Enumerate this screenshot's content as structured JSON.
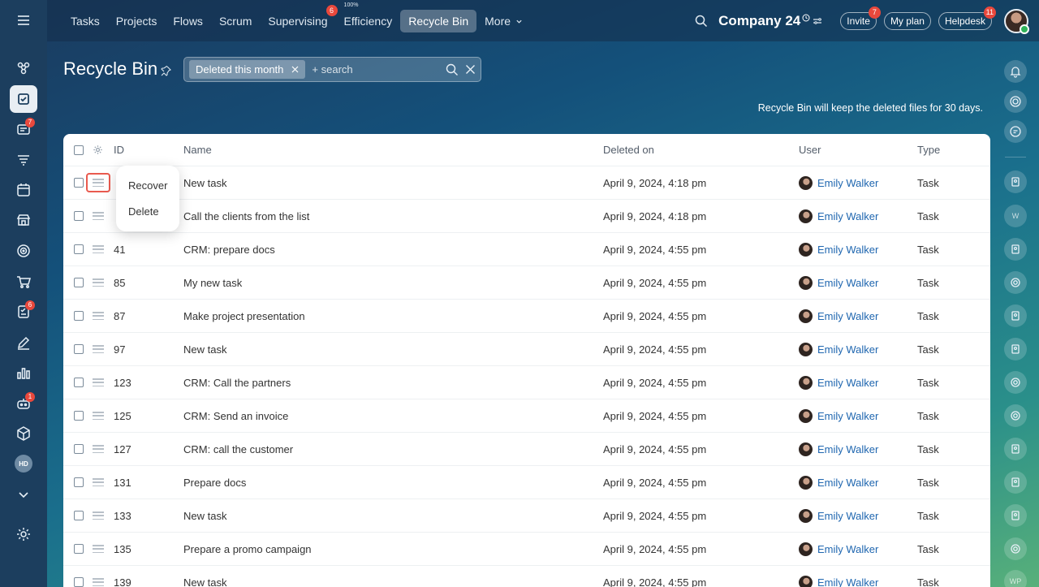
{
  "topbar": {
    "nav": [
      {
        "label": "Tasks"
      },
      {
        "label": "Projects"
      },
      {
        "label": "Flows"
      },
      {
        "label": "Scrum"
      },
      {
        "label": "Supervising",
        "badge": "6"
      },
      {
        "label": "Efficiency",
        "tiny": "100%"
      },
      {
        "label": "Recycle Bin",
        "active": true
      },
      {
        "label": "More"
      }
    ],
    "company": "Company 24",
    "invite_label": "Invite",
    "invite_badge": "7",
    "myplan_label": "My plan",
    "helpdesk_label": "Helpdesk",
    "helpdesk_badge": "11"
  },
  "leftbar": {
    "badges": {
      "feed": "7",
      "tasks2": "6",
      "robot": "1"
    },
    "hd_label": "HD"
  },
  "rightbar": {
    "w_label": "W",
    "wp_label": "WP"
  },
  "page": {
    "title": "Recycle Bin",
    "filter_chip": "Deleted this month",
    "search_placeholder": "+ search",
    "hint": "Recycle Bin will keep the deleted files for 30 days."
  },
  "table": {
    "headers": {
      "id": "ID",
      "name": "Name",
      "deleted_on": "Deleted on",
      "user": "User",
      "type": "Type"
    },
    "rows": [
      {
        "id": "",
        "name": "New task",
        "deleted_on": "April 9, 2024, 4:18 pm",
        "user": "Emily Walker",
        "type": "Task"
      },
      {
        "id": "",
        "name": "Call the clients from the list",
        "deleted_on": "April 9, 2024, 4:18 pm",
        "user": "Emily Walker",
        "type": "Task"
      },
      {
        "id": "41",
        "name": "CRM: prepare docs",
        "deleted_on": "April 9, 2024, 4:55 pm",
        "user": "Emily Walker",
        "type": "Task"
      },
      {
        "id": "85",
        "name": "My new task",
        "deleted_on": "April 9, 2024, 4:55 pm",
        "user": "Emily Walker",
        "type": "Task"
      },
      {
        "id": "87",
        "name": "Make project presentation",
        "deleted_on": "April 9, 2024, 4:55 pm",
        "user": "Emily Walker",
        "type": "Task"
      },
      {
        "id": "97",
        "name": "New task",
        "deleted_on": "April 9, 2024, 4:55 pm",
        "user": "Emily Walker",
        "type": "Task"
      },
      {
        "id": "123",
        "name": "CRM: Call the partners",
        "deleted_on": "April 9, 2024, 4:55 pm",
        "user": "Emily Walker",
        "type": "Task"
      },
      {
        "id": "125",
        "name": "CRM: Send an invoice",
        "deleted_on": "April 9, 2024, 4:55 pm",
        "user": "Emily Walker",
        "type": "Task"
      },
      {
        "id": "127",
        "name": "CRM: call the customer",
        "deleted_on": "April 9, 2024, 4:55 pm",
        "user": "Emily Walker",
        "type": "Task"
      },
      {
        "id": "131",
        "name": "Prepare docs",
        "deleted_on": "April 9, 2024, 4:55 pm",
        "user": "Emily Walker",
        "type": "Task"
      },
      {
        "id": "133",
        "name": "New task",
        "deleted_on": "April 9, 2024, 4:55 pm",
        "user": "Emily Walker",
        "type": "Task"
      },
      {
        "id": "135",
        "name": "Prepare a promo campaign",
        "deleted_on": "April 9, 2024, 4:55 pm",
        "user": "Emily Walker",
        "type": "Task"
      },
      {
        "id": "139",
        "name": "New task",
        "deleted_on": "April 9, 2024, 4:55 pm",
        "user": "Emily Walker",
        "type": "Task"
      }
    ]
  },
  "context_menu": {
    "recover_label": "Recover",
    "delete_label": "Delete"
  }
}
